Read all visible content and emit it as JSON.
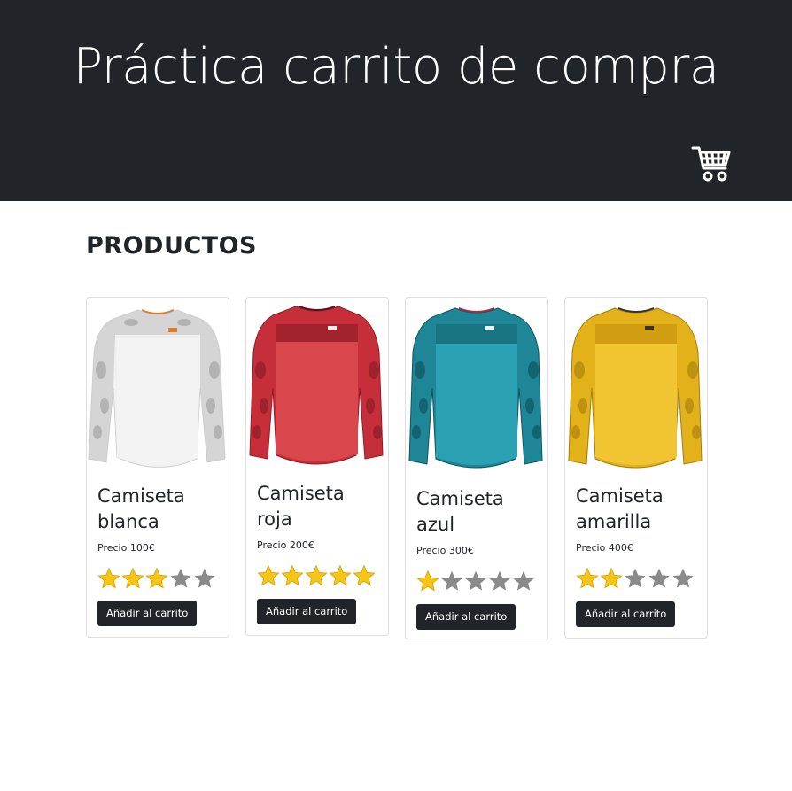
{
  "header": {
    "title": "Práctica carrito de compra"
  },
  "section": {
    "title": "PRODUCTOS"
  },
  "cart_icon": "shopping-cart-icon",
  "colors": {
    "header_bg": "#212529",
    "star_filled": "#f5c518",
    "star_empty": "#8a8a8a",
    "button_bg": "#212529"
  },
  "products": [
    {
      "name": "Camiseta blanca",
      "price": "Precio 100€",
      "rating": 3,
      "max_rating": 5,
      "button": "Añadir al carrito",
      "color": "white"
    },
    {
      "name": "Camiseta roja",
      "price": "Precio 200€",
      "rating": 5,
      "max_rating": 5,
      "button": "Añadir al carrito",
      "color": "red"
    },
    {
      "name": "Camiseta azul",
      "price": "Precio 300€",
      "rating": 1,
      "max_rating": 5,
      "button": "Añadir al carrito",
      "color": "teal"
    },
    {
      "name": "Camiseta amarilla",
      "price": "Precio 400€",
      "rating": 2,
      "max_rating": 5,
      "button": "Añadir al carrito",
      "color": "yellow"
    }
  ]
}
